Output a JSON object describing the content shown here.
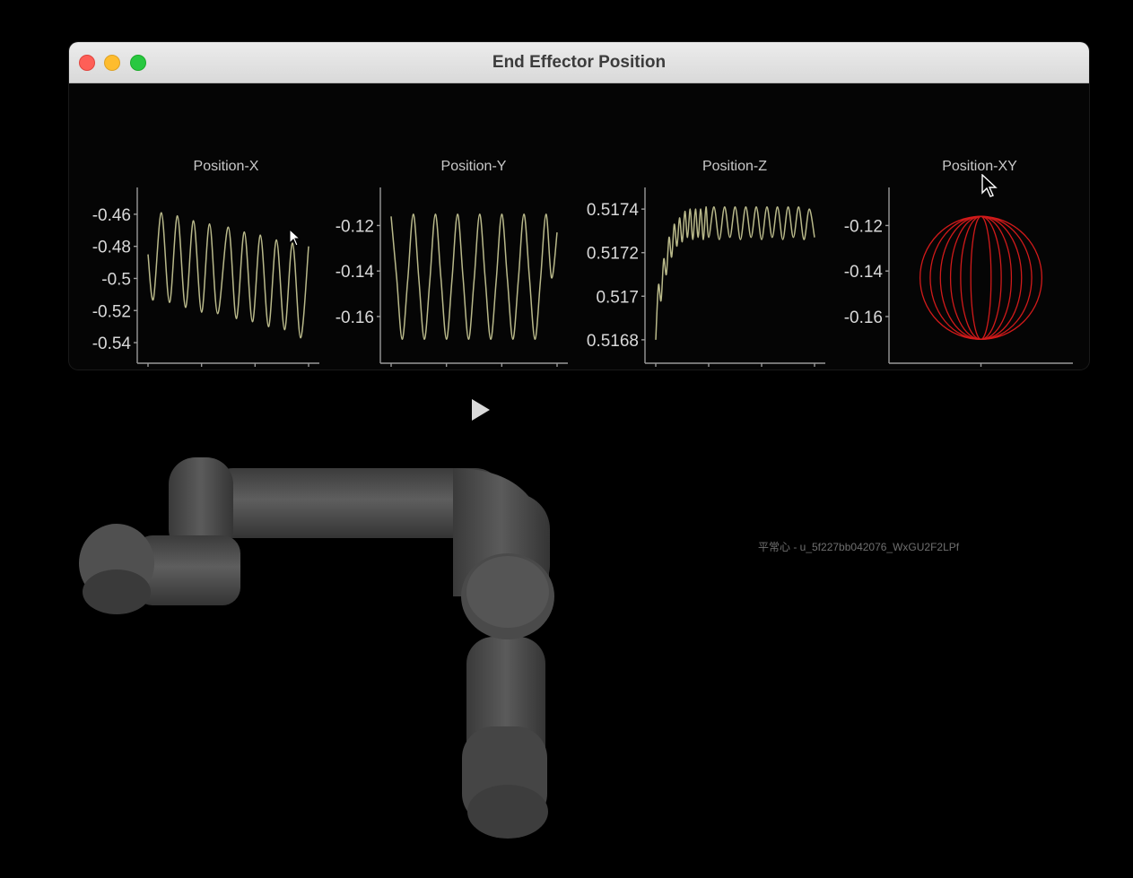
{
  "window": {
    "title": "End Effector Position",
    "controls": [
      "close",
      "minimize",
      "maximize"
    ],
    "colors": {
      "close": "#fe5f57",
      "minimize": "#febc2e",
      "maximize": "#28c840",
      "trace_time": "#b9b98a",
      "trace_xy": "#d11a1a"
    }
  },
  "chart_data": [
    {
      "type": "line",
      "title": "Position-X",
      "xlabel": "",
      "ylabel": "",
      "xlim": [
        0,
        300
      ],
      "ylim": [
        -0.545,
        -0.45
      ],
      "xticks": [
        "0",
        "100",
        "200",
        "300"
      ],
      "yticks": [
        "-0.46",
        "-0.48",
        "-0.5",
        "-0.52",
        "-0.54"
      ],
      "series": [
        {
          "x": [
            0,
            10,
            25,
            40,
            55,
            70,
            85,
            100,
            115,
            130,
            150,
            165,
            180,
            195,
            210,
            225,
            240,
            255,
            270,
            285,
            300
          ],
          "y": [
            -0.485,
            -0.513,
            -0.459,
            -0.515,
            -0.461,
            -0.518,
            -0.464,
            -0.521,
            -0.466,
            -0.522,
            -0.468,
            -0.525,
            -0.471,
            -0.527,
            -0.473,
            -0.53,
            -0.476,
            -0.532,
            -0.478,
            -0.537,
            -0.48
          ]
        }
      ]
    },
    {
      "type": "line",
      "title": "Position-Y",
      "xlabel": "",
      "ylabel": "",
      "xlim": [
        0,
        300
      ],
      "ylim": [
        -0.175,
        -0.108
      ],
      "xticks": [
        "0",
        "100",
        "200",
        "300"
      ],
      "yticks": [
        "-0.12",
        "-0.14",
        "-0.16"
      ],
      "series": [
        {
          "x": [
            0,
            10,
            20,
            30,
            40,
            50,
            60,
            70,
            80,
            90,
            100,
            110,
            120,
            130,
            140,
            150,
            160,
            170,
            180,
            190,
            200,
            210,
            220,
            230,
            240,
            250,
            260,
            270,
            280,
            290,
            300
          ],
          "y": [
            -0.116,
            -0.143,
            -0.17,
            -0.144,
            -0.115,
            -0.143,
            -0.17,
            -0.144,
            -0.115,
            -0.143,
            -0.17,
            -0.144,
            -0.115,
            -0.143,
            -0.17,
            -0.144,
            -0.115,
            -0.143,
            -0.17,
            -0.144,
            -0.115,
            -0.143,
            -0.17,
            -0.144,
            -0.115,
            -0.143,
            -0.17,
            -0.144,
            -0.115,
            -0.143,
            -0.123
          ]
        }
      ]
    },
    {
      "type": "line",
      "title": "Position-Z",
      "xlabel": "",
      "ylabel": "",
      "xlim": [
        0,
        300
      ],
      "ylim": [
        0.51675,
        0.51745
      ],
      "xticks": [
        "0",
        "100",
        "200",
        "300"
      ],
      "yticks": [
        "0.5174",
        "0.5172",
        "0.517",
        "0.5168"
      ],
      "series": [
        {
          "x": [
            0,
            5,
            10,
            15,
            20,
            25,
            30,
            35,
            40,
            45,
            50,
            55,
            60,
            65,
            70,
            75,
            80,
            85,
            90,
            95,
            100,
            110,
            120,
            130,
            140,
            150,
            160,
            170,
            180,
            190,
            200,
            210,
            220,
            230,
            240,
            250,
            260,
            270,
            280,
            290,
            300
          ],
          "y": [
            0.5168,
            0.51705,
            0.51698,
            0.51717,
            0.5171,
            0.51727,
            0.51718,
            0.51733,
            0.51723,
            0.51736,
            0.51725,
            0.51739,
            0.51727,
            0.5174,
            0.51726,
            0.5174,
            0.51727,
            0.5174,
            0.51726,
            0.51741,
            0.51727,
            0.51741,
            0.51726,
            0.51741,
            0.51727,
            0.51741,
            0.51726,
            0.51741,
            0.51727,
            0.51741,
            0.51726,
            0.51741,
            0.51727,
            0.51741,
            0.51726,
            0.51741,
            0.51727,
            0.51741,
            0.51726,
            0.5174,
            0.51727
          ]
        }
      ]
    },
    {
      "type": "line",
      "title": "Position-XY",
      "xlabel": "",
      "ylabel": "",
      "xlim": [
        -0.54,
        -0.46
      ],
      "ylim": [
        -0.175,
        -0.108
      ],
      "xticks": [
        "-0.5"
      ],
      "yticks": [
        "-0.12",
        "-0.14",
        "-0.16"
      ],
      "series": [
        {
          "loops": [
            {
              "center_x": -0.5,
              "center_y": -0.143,
              "radius_x": 0.03,
              "radius_y": 0.027
            },
            {
              "center_x": -0.5,
              "center_y": -0.143,
              "radius_x": 0.025,
              "radius_y": 0.027
            },
            {
              "center_x": -0.5,
              "center_y": -0.143,
              "radius_x": 0.02,
              "radius_y": 0.027
            },
            {
              "center_x": -0.5,
              "center_y": -0.143,
              "radius_x": 0.015,
              "radius_y": 0.027
            },
            {
              "center_x": -0.5,
              "center_y": -0.143,
              "radius_x": 0.01,
              "radius_y": 0.027
            },
            {
              "center_x": -0.5,
              "center_y": -0.143,
              "radius_x": 0.005,
              "radius_y": 0.027
            }
          ]
        }
      ]
    }
  ],
  "player": {
    "play_icon": "play-icon"
  },
  "viewport": {
    "object": "robot-arm",
    "color": "#4a4a4a"
  },
  "watermark": "平常心 - u_5f227bb042076_WxGU2F2LPf"
}
